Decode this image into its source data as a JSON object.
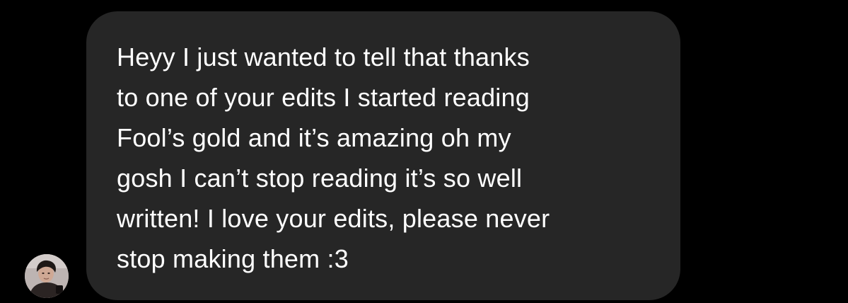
{
  "conversation": {
    "messages": [
      {
        "direction": "received",
        "lines": "Heyy I just wanted to tell that thanks\nto one of your edits I started reading\nFool’s gold and it’s amazing oh my\ngosh I can’t stop reading it’s so well\nwritten! I love your edits, please never\nstop making them :3"
      }
    ],
    "sender": {
      "avatar_icon": "profile-photo"
    }
  },
  "colors": {
    "background": "#000000",
    "bubble": "#262626",
    "text": "#ffffff"
  }
}
